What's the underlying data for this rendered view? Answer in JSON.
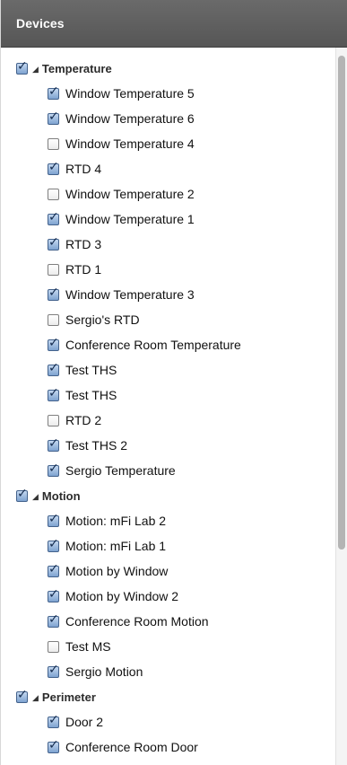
{
  "header": {
    "title": "Devices"
  },
  "groups": [
    {
      "label": "Temperature",
      "checked": true,
      "items": [
        {
          "label": "Window Temperature 5",
          "checked": true
        },
        {
          "label": "Window Temperature 6",
          "checked": true
        },
        {
          "label": "Window Temperature 4",
          "checked": false
        },
        {
          "label": "RTD 4",
          "checked": true
        },
        {
          "label": "Window Temperature 2",
          "checked": false
        },
        {
          "label": "Window Temperature 1",
          "checked": true
        },
        {
          "label": "RTD 3",
          "checked": true
        },
        {
          "label": "RTD 1",
          "checked": false
        },
        {
          "label": "Window Temperature 3",
          "checked": true
        },
        {
          "label": "Sergio's RTD",
          "checked": false
        },
        {
          "label": "Conference Room Temperature",
          "checked": true
        },
        {
          "label": "Test THS",
          "checked": true
        },
        {
          "label": "Test THS",
          "checked": true
        },
        {
          "label": "RTD 2",
          "checked": false
        },
        {
          "label": "Test THS 2",
          "checked": true
        },
        {
          "label": "Sergio Temperature",
          "checked": true
        }
      ]
    },
    {
      "label": "Motion",
      "checked": true,
      "items": [
        {
          "label": "Motion: mFi Lab 2",
          "checked": true
        },
        {
          "label": "Motion: mFi Lab 1",
          "checked": true
        },
        {
          "label": "Motion by Window",
          "checked": true
        },
        {
          "label": "Motion by Window 2",
          "checked": true
        },
        {
          "label": "Conference Room Motion",
          "checked": true
        },
        {
          "label": "Test MS",
          "checked": false
        },
        {
          "label": "Sergio Motion",
          "checked": true
        }
      ]
    },
    {
      "label": "Perimeter",
      "checked": true,
      "items": [
        {
          "label": "Door 2",
          "checked": true
        },
        {
          "label": "Conference Room Door",
          "checked": true
        }
      ]
    }
  ],
  "colors": {
    "header_bg": "#5f5f5f",
    "checkbox_checked": "#7ea3d0",
    "checkmark": "#142b4e"
  },
  "icons": {
    "expand": "triangle-expanded-icon",
    "check": "checkmark-icon"
  }
}
